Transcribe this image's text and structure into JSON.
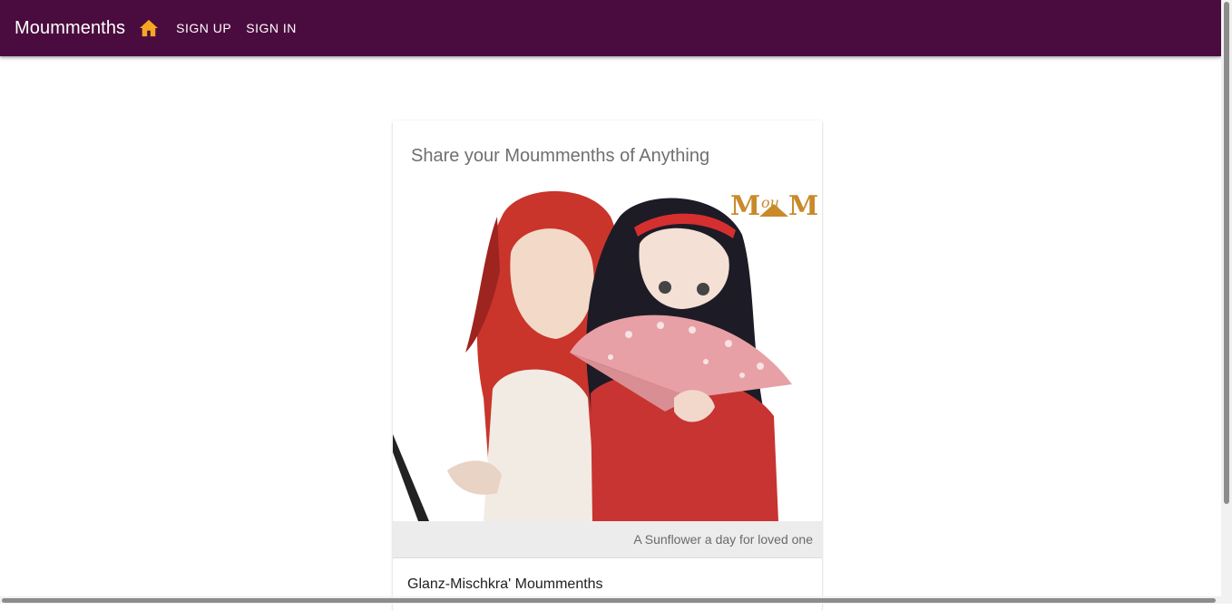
{
  "appbar": {
    "brand": "Moummenths",
    "home_icon": "home-icon",
    "nav": [
      {
        "label": "SIGN UP"
      },
      {
        "label": "SIGN IN"
      }
    ],
    "background_color": "#4a0c3e",
    "home_icon_color": "#f5a623"
  },
  "card": {
    "title": "Share your Moummenths of Anything",
    "image": {
      "logo_text": "MouM",
      "description_icon": "anime-illustration"
    },
    "caption": "A Sunflower a day for loved one",
    "subtitle": "Glanz-Mischkra' Moummenths"
  }
}
